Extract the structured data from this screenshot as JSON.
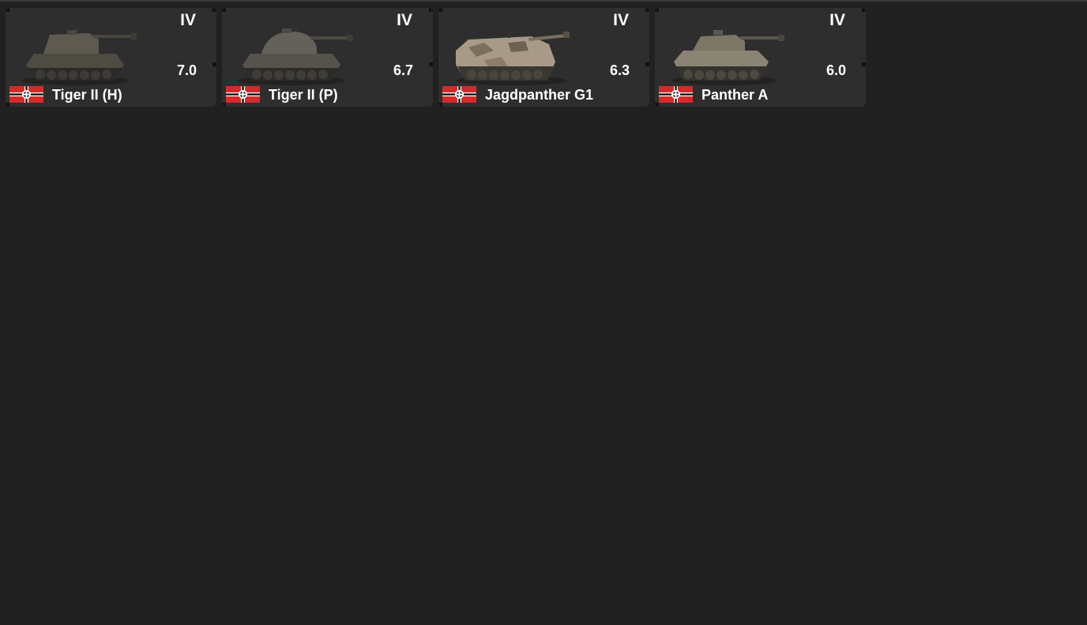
{
  "vehicles": [
    {
      "name": "Tiger II (H)",
      "tier": "IV",
      "battle_rating": "7.0",
      "nation_flag_icon": "germany-flag-icon",
      "hull_color": "#5a564c"
    },
    {
      "name": "Tiger II (P)",
      "tier": "IV",
      "battle_rating": "6.7",
      "nation_flag_icon": "germany-flag-icon",
      "hull_color": "#5c5a52"
    },
    {
      "name": "Jagdpanther G1",
      "tier": "IV",
      "battle_rating": "6.3",
      "nation_flag_icon": "germany-flag-icon",
      "hull_color": "#a89a86"
    },
    {
      "name": "Panther A",
      "tier": "IV",
      "battle_rating": "6.0",
      "nation_flag_icon": "germany-flag-icon",
      "hull_color": "#8a8474"
    }
  ],
  "colors": {
    "background": "#212121",
    "card": "#2e2e2e",
    "flag_red": "#d42a2a",
    "text": "#ffffff"
  }
}
